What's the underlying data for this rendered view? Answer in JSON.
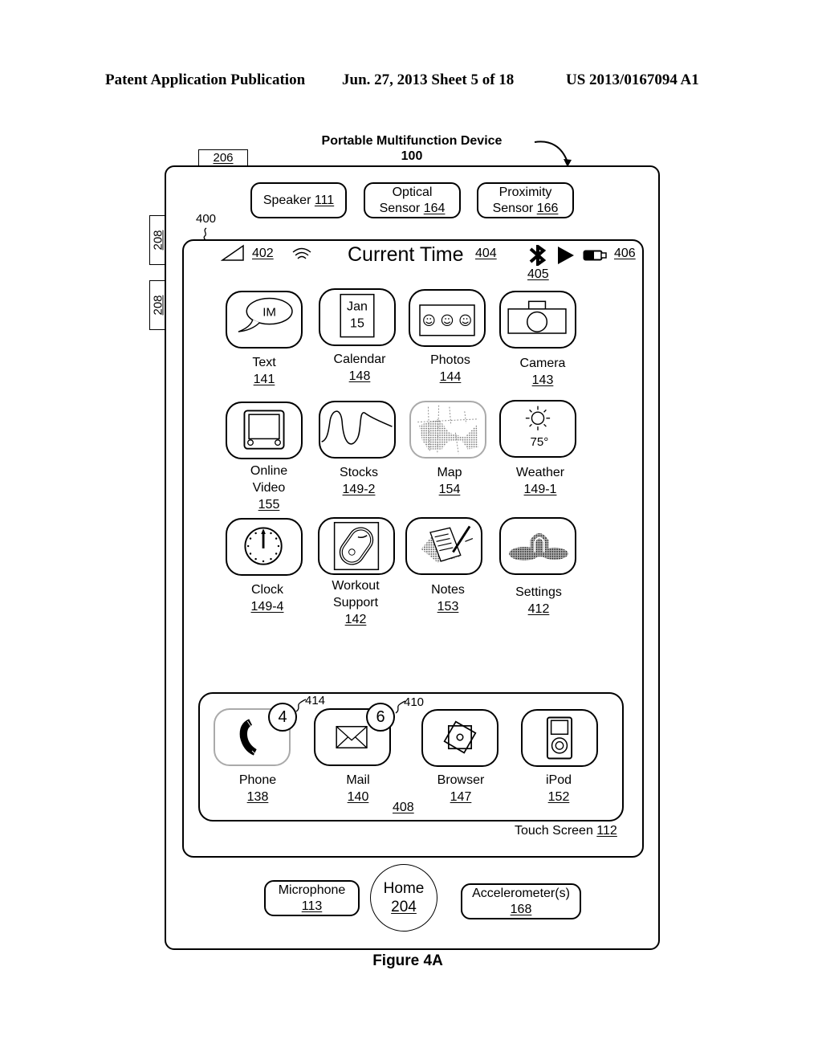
{
  "header": {
    "publication": "Patent Application Publication",
    "date_sheet": "Jun. 27, 2013  Sheet 5 of 18",
    "patent_number": "US 2013/0167094 A1"
  },
  "device": {
    "title": "Portable Multifunction Device",
    "ref": "100",
    "side_button_top": "206",
    "side_buttons_left": [
      "208",
      "208"
    ],
    "screen_ref": "400"
  },
  "sensors": [
    {
      "label": "Speaker",
      "ref": "111"
    },
    {
      "label": "Optical",
      "label2": "Sensor",
      "ref": "164"
    },
    {
      "label": "Proximity",
      "label2": "Sensor",
      "ref": "166"
    }
  ],
  "status_bar": {
    "signal_ref": "402",
    "time_label": "Current Time",
    "time_ref": "404",
    "bt_play_ref": "405",
    "battery_ref": "406"
  },
  "apps": [
    {
      "name": "Text",
      "ref": "141",
      "icon": "speech-bubble-icon",
      "icon_text": "IM"
    },
    {
      "name": "Calendar",
      "ref": "148",
      "icon": "calendar-icon",
      "icon_text": "Jan",
      "icon_text2": "15"
    },
    {
      "name": "Photos",
      "ref": "144",
      "icon": "photos-icon"
    },
    {
      "name": "Camera",
      "ref": "143",
      "icon": "camera-icon"
    },
    {
      "name": "Online",
      "name2": "Video",
      "ref": "155",
      "icon": "video-screen-icon"
    },
    {
      "name": "Stocks",
      "ref": "149-2",
      "icon": "stock-chart-icon"
    },
    {
      "name": "Map",
      "ref": "154",
      "icon": "map-icon"
    },
    {
      "name": "Weather",
      "ref": "149-1",
      "icon": "sun-icon",
      "icon_text": "75°"
    },
    {
      "name": "Clock",
      "ref": "149-4",
      "icon": "clock-icon"
    },
    {
      "name": "Workout",
      "name2": "Support",
      "ref": "142",
      "icon": "workout-icon"
    },
    {
      "name": "Notes",
      "ref": "153",
      "icon": "notepad-icon"
    },
    {
      "name": "Settings",
      "ref": "412",
      "icon": "gears-icon"
    }
  ],
  "tray": {
    "ref": "408",
    "apps": [
      {
        "name": "Phone",
        "ref": "138",
        "icon": "phone-icon",
        "badge": "4",
        "badge_ref": "414"
      },
      {
        "name": "Mail",
        "ref": "140",
        "icon": "envelope-icon",
        "badge": "6",
        "badge_ref": "410"
      },
      {
        "name": "Browser",
        "ref": "147",
        "icon": "compass-icon"
      },
      {
        "name": "iPod",
        "ref": "152",
        "icon": "ipod-icon"
      }
    ]
  },
  "touch_screen": {
    "label": "Touch Screen",
    "ref": "112"
  },
  "bottom": {
    "microphone": {
      "label": "Microphone",
      "ref": "113"
    },
    "home": {
      "label": "Home",
      "ref": "204"
    },
    "accelerometer": {
      "label": "Accelerometer(s)",
      "ref": "168"
    }
  },
  "figure_caption": "Figure 4A"
}
